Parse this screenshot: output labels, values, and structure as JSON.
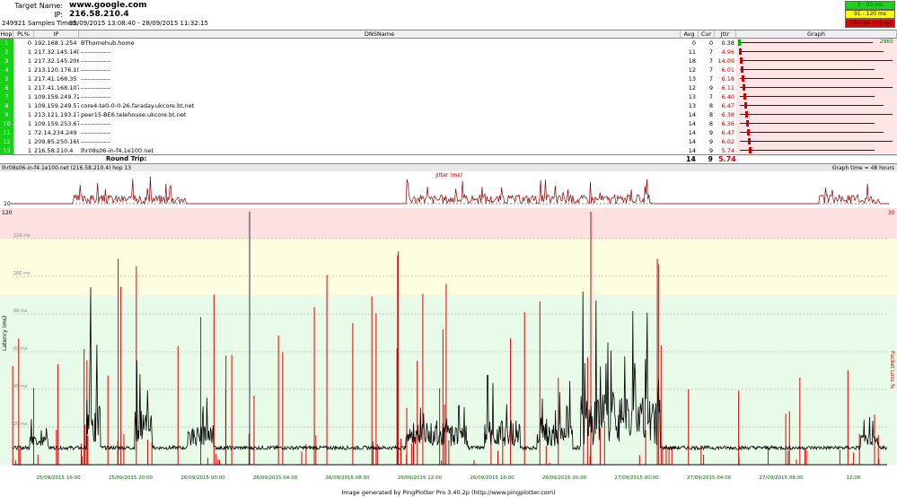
{
  "header": {
    "target_label": "Target Name:",
    "target_value": "www.google.com",
    "ip_label": "IP:",
    "ip_value": "216.58.210.4",
    "samples_label": "249921 Samples Timed:",
    "samples_value": "25/09/2015 13:08:40 - 28/09/2015 11:32:15",
    "legend": [
      {
        "label": "0 - 90 ms",
        "color": "#1fd11f"
      },
      {
        "label": "91 - 120 ms",
        "color": "#ffff00"
      },
      {
        "label": "121 ms and up",
        "color": "#e00000"
      }
    ]
  },
  "columns": {
    "hop": "Hop",
    "pl": "PL%",
    "ip": "IP",
    "dns": "DNSName",
    "avg": "Avg",
    "cur": "Cur",
    "jttr": "Jttr",
    "graph": "Graph"
  },
  "hops": [
    {
      "hop": "1",
      "pl": "0",
      "ip": "192.168.1.254",
      "dns": "BThomehub.home",
      "avg": "0",
      "cur": "0",
      "jttr": "0.38"
    },
    {
      "hop": "2",
      "pl": "1",
      "ip": "217.32.145.140",
      "dns": "--------------",
      "avg": "11",
      "cur": "7",
      "jttr": "4.96"
    },
    {
      "hop": "3",
      "pl": "1",
      "ip": "217.32.145.206",
      "dns": "--------------",
      "avg": "18",
      "cur": "7",
      "jttr": "14.09"
    },
    {
      "hop": "4",
      "pl": "1",
      "ip": "213.120.176.10",
      "dns": "--------------",
      "avg": "12",
      "cur": "7",
      "jttr": "6.01"
    },
    {
      "hop": "5",
      "pl": "1",
      "ip": "217.41.168.35",
      "dns": "--------------",
      "avg": "13",
      "cur": "7",
      "jttr": "6.18"
    },
    {
      "hop": "6",
      "pl": "1",
      "ip": "217.41.168.107",
      "dns": "--------------",
      "avg": "12",
      "cur": "9",
      "jttr": "6.11"
    },
    {
      "hop": "7",
      "pl": "1",
      "ip": "109.159.249.72",
      "dns": "--------------",
      "avg": "13",
      "cur": "7",
      "jttr": "6.40"
    },
    {
      "hop": "8",
      "pl": "1",
      "ip": "109.159.249.57",
      "dns": "core4-te0-0-0-26.faraday.ukcore.bt.net",
      "avg": "13",
      "cur": "8",
      "jttr": "6.47"
    },
    {
      "hop": "9",
      "pl": "1",
      "ip": "213.121.193.175",
      "dns": "peer15-BE6.telehouse.ukcore.bt.net",
      "avg": "14",
      "cur": "8",
      "jttr": "6.38"
    },
    {
      "hop": "10",
      "pl": "1",
      "ip": "109.159.253.67",
      "dns": "--------------",
      "avg": "14",
      "cur": "8",
      "jttr": "6.36"
    },
    {
      "hop": "11",
      "pl": "1",
      "ip": "72.14.234.249",
      "dns": "--------------",
      "avg": "14",
      "cur": "9",
      "jttr": "6.47"
    },
    {
      "hop": "12",
      "pl": "1",
      "ip": "209.85.250.169",
      "dns": "--------------",
      "avg": "14",
      "cur": "9",
      "jttr": "6.02"
    },
    {
      "hop": "13",
      "pl": "1",
      "ip": "216.58.210.4",
      "dns": "lhr08s06-in-f4.1e100.net",
      "avg": "14",
      "cur": "9",
      "jttr": "5.74"
    }
  ],
  "graph_col_value": "2965",
  "round_trip": {
    "label": "Round Trip:",
    "avg": "14",
    "cur": "9",
    "jttr": "5.74"
  },
  "chart_bar": {
    "left": "lhr08s06-in-f4.1e100.net (216.58.210.4) hop 13",
    "right": "Graph time = 48 hours"
  },
  "jitter_title": "Jitter (ms)",
  "jitter_axis": {
    "top": "10",
    "left_bottom": "120",
    "right_bottom": "30"
  },
  "chart_data": {
    "type": "line",
    "title": "Jitter (ms)",
    "ylabel": "Latency (ms)",
    "y2label": "Packet Loss %",
    "ylim": [
      0,
      130
    ],
    "yticks": [
      "120 ms",
      "100 ms",
      "80 ms",
      "60 ms",
      "40 ms",
      "20 ms",
      "0"
    ],
    "y_tick_values": [
      120,
      100,
      80,
      60,
      40,
      20,
      0
    ],
    "zones": [
      {
        "from": 0,
        "to": 90,
        "color": "#e8fbe8"
      },
      {
        "from": 90,
        "to": 120,
        "color": "#fdfde0"
      },
      {
        "from": 120,
        "to": 130,
        "color": "#fde0e0"
      }
    ],
    "x_labels": [
      "25/09/2015 16:00",
      "25/09/2015 20:00",
      "26/09/2015 00:00",
      "26/09/2015 04:00",
      "26/09/2015 08:00",
      "26/09/2015 12:00",
      "26/09/2015 16:00",
      "26/09/2015 20:00",
      "27/09/2015 00:00",
      "27/09/2015 04:00",
      "27/09/2015 08:00",
      "12:00"
    ],
    "series": [
      {
        "color": "#000000",
        "bursts": [
          [
            0.02,
            0.04,
            15
          ],
          [
            0.085,
            0.1,
            85
          ],
          [
            0.14,
            0.16,
            55
          ],
          [
            0.2,
            0.23,
            30
          ],
          [
            0.45,
            0.52,
            35
          ],
          [
            0.54,
            0.58,
            40
          ],
          [
            0.6,
            0.64,
            35
          ],
          [
            0.65,
            0.69,
            85
          ],
          [
            0.69,
            0.74,
            75
          ],
          [
            0.97,
            0.99,
            18
          ]
        ]
      },
      {
        "color": "#e00000",
        "name": "Packet Loss"
      }
    ],
    "baseline_ms": 8
  },
  "footer": "Image generated by PingPlotter Pro 3.40.2p (http://www.pingplotter.com)"
}
